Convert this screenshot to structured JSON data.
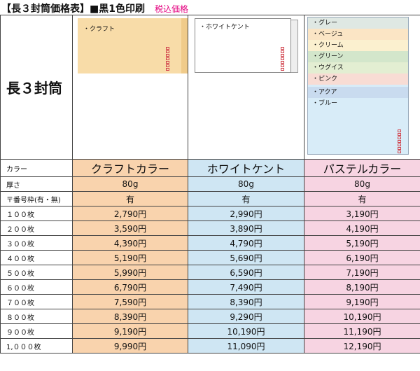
{
  "header": {
    "title": "【長３封筒価格表】■黒1色印刷",
    "tax_note": "税込価格"
  },
  "envelope_name": "長３封筒",
  "illustrations": {
    "kraft_label": "・クラフト",
    "white_label": "・ホワイトケント",
    "pastel_labels": [
      "・グレー",
      "・ベージュ",
      "・クリーム",
      "・グリーン",
      "・ウグイス",
      "・ピンク",
      "・アクア",
      "・ブルー"
    ],
    "colors": {
      "kraft": "#f8dca8",
      "white": "#ffffff",
      "pastel": [
        "#dfe8e3",
        "#fbe5c5",
        "#fbf0cf",
        "#d3e6cb",
        "#e3eed2",
        "#f8dcd4",
        "#c9dbef",
        "#d8ecf8"
      ]
    }
  },
  "table": {
    "color_row": {
      "label": "カラー",
      "values": [
        "クラフトカラー",
        "ホワイトケント",
        "パステルカラー"
      ]
    },
    "thickness_row": {
      "label": "厚さ",
      "values": [
        "80g",
        "80g",
        "80g"
      ]
    },
    "postal_row": {
      "label": "〒番号枠(有・無)",
      "values": [
        "有",
        "有",
        "有"
      ]
    },
    "price_rows": [
      {
        "qty": "１００枚",
        "prices": [
          "2,790円",
          "2,990円",
          "3,190円"
        ]
      },
      {
        "qty": "２００枚",
        "prices": [
          "3,590円",
          "3,890円",
          "4,190円"
        ]
      },
      {
        "qty": "３００枚",
        "prices": [
          "4,390円",
          "4,790円",
          "5,190円"
        ]
      },
      {
        "qty": "４００枚",
        "prices": [
          "5,190円",
          "5,690円",
          "6,190円"
        ]
      },
      {
        "qty": "５００枚",
        "prices": [
          "5,990円",
          "6,590円",
          "7,190円"
        ]
      },
      {
        "qty": "６００枚",
        "prices": [
          "6,790円",
          "7,490円",
          "8,190円"
        ]
      },
      {
        "qty": "７００枚",
        "prices": [
          "7,590円",
          "8,390円",
          "9,190円"
        ]
      },
      {
        "qty": "８００枚",
        "prices": [
          "8,390円",
          "9,290円",
          "10,190円"
        ]
      },
      {
        "qty": "９００枚",
        "prices": [
          "9,190円",
          "10,190円",
          "11,190円"
        ]
      },
      {
        "qty": "1,０００枚",
        "prices": [
          "9,990円",
          "11,090円",
          "12,190円"
        ]
      }
    ],
    "column_colors": {
      "kraft": "#f9d3ad",
      "white": "#cfe6f3",
      "pastel": "#f7d4e2"
    }
  }
}
